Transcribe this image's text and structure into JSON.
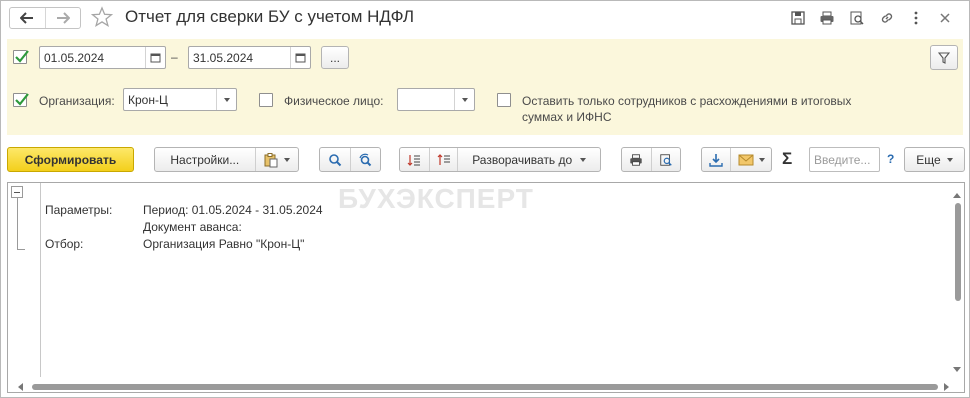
{
  "window": {
    "title": "Отчет для сверки БУ с учетом НДФЛ",
    "icons": [
      "back-arrow-icon",
      "forward-arrow-icon",
      "favorite-star-icon",
      "save-icon",
      "print-icon",
      "preview-icon",
      "link-icon",
      "more-vertical-icon",
      "close-icon"
    ]
  },
  "filters": {
    "period": {
      "checked": true,
      "from": "01.05.2024",
      "dash": "–",
      "to": "31.05.2024",
      "more_label": "..."
    },
    "organization": {
      "checked": true,
      "label": "Организация:",
      "value": "Крон-Ц"
    },
    "individual": {
      "checked": false,
      "label": "Физическое лицо:",
      "value": ""
    },
    "discrepancies": {
      "checked": false,
      "label_line1": "Оставить только сотрудников с расхождениями в итоговых",
      "label_line2": "суммах и ИФНС"
    }
  },
  "toolbar": {
    "generate_label": "Сформировать",
    "settings_label": "Настройки...",
    "expand_label": "Разворачивать до",
    "sum_symbol": "Σ",
    "search_placeholder": "Введите...",
    "help_symbol": "?",
    "more_label": "Еще"
  },
  "report": {
    "watermark": "БУХЭКСПЕРТ",
    "params_label": "Параметры:",
    "period_line": "Период: 01.05.2024 - 31.05.2024",
    "advance_line": "Документ аванса:",
    "filter_label": "Отбор:",
    "filter_value": "Организация Равно \"Крон-Ц\""
  },
  "colors": {
    "accent_yellow": "#f3cf1b",
    "filter_bg": "#fbf7dc",
    "check_green": "#2e9a3c",
    "icon_blue": "#2b6cb0"
  }
}
